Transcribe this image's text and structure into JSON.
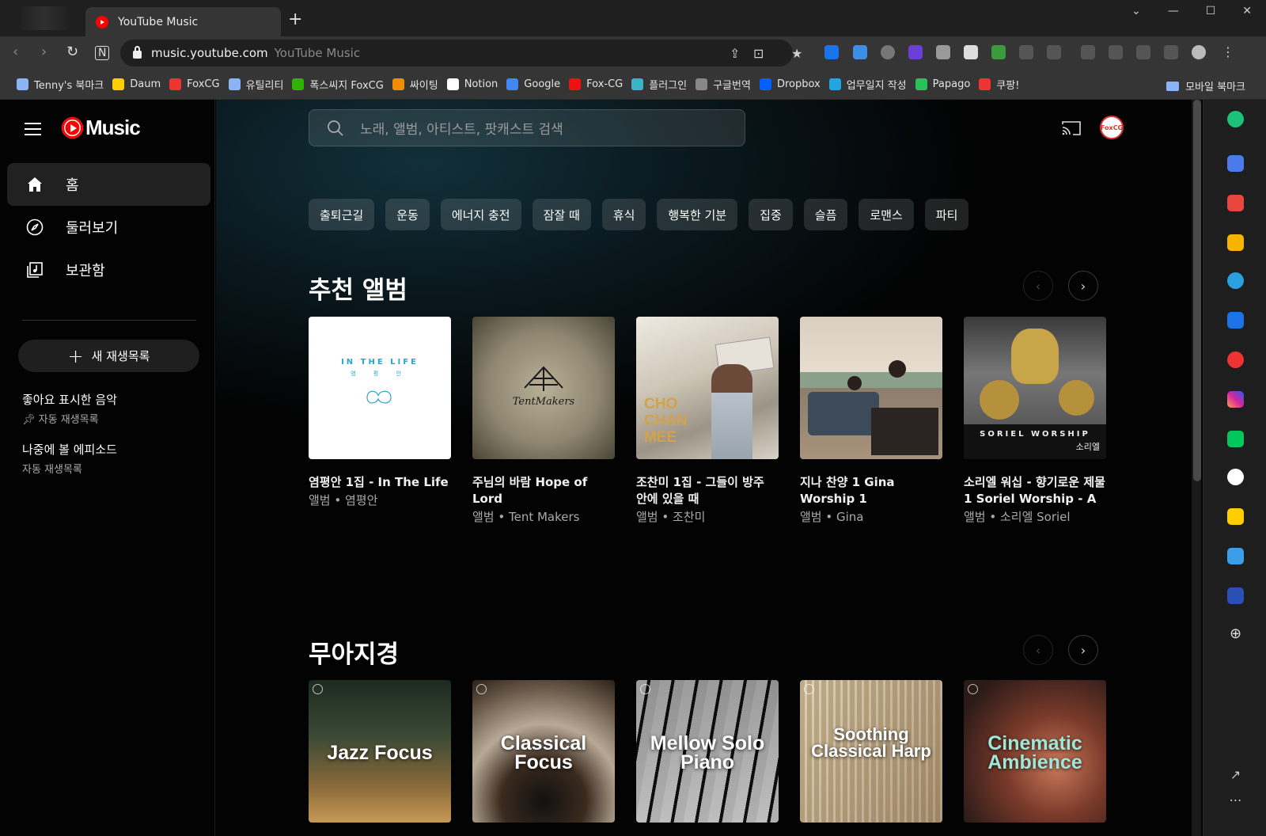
{
  "browser": {
    "tab_title": "YouTube Music",
    "new_tab": "+",
    "url": "music.youtube.com",
    "page_title": "YouTube Music",
    "bookmarks": [
      {
        "label": "Tenny's 북마크",
        "color": "#8ab4f8"
      },
      {
        "label": "Daum",
        "color": "#ffcd00"
      },
      {
        "label": "FoxCG",
        "color": "#e33"
      },
      {
        "label": "유틸리티",
        "color": "#8ab4f8"
      },
      {
        "label": "폭스씨지 FoxCG",
        "color": "#2db400"
      },
      {
        "label": "싸이팅",
        "color": "#f28c00"
      },
      {
        "label": "Notion",
        "color": "#ffffff"
      },
      {
        "label": "Google",
        "color": "#4285f4"
      },
      {
        "label": "Fox-CG",
        "color": "#e11"
      },
      {
        "label": "플러그인",
        "color": "#3cb4c8"
      },
      {
        "label": "구글번역",
        "color": "#888888"
      },
      {
        "label": "Dropbox",
        "color": "#0061ff"
      },
      {
        "label": "업무일지 작성",
        "color": "#1ea7e1"
      },
      {
        "label": "Papago",
        "color": "#28c15a"
      },
      {
        "label": "쿠팡!",
        "color": "#e33"
      }
    ],
    "mobile_bookmarks": "모바일 북마크"
  },
  "app": {
    "logo_text": "Music",
    "nav": [
      {
        "label": "홈",
        "icon": "home-icon",
        "active": true
      },
      {
        "label": "둘러보기",
        "icon": "compass-icon",
        "active": false
      },
      {
        "label": "보관함",
        "icon": "library-icon",
        "active": false
      }
    ],
    "new_playlist": "새 재생목록",
    "library": [
      {
        "title": "좋아요 표시한 음악",
        "subtitle": "자동 재생목록",
        "pinned": true
      },
      {
        "title": "나중에 볼 에피소드",
        "subtitle": "자동 재생목록",
        "pinned": false
      }
    ],
    "search_placeholder": "노래, 앨범, 아티스트, 팟캐스트 검색",
    "avatar_text": "FoxCG",
    "chips": [
      "출퇴근길",
      "운동",
      "에너지 충전",
      "잠잘 때",
      "휴식",
      "행복한 기분",
      "집중",
      "슬픔",
      "로맨스",
      "파티"
    ],
    "shelves": [
      {
        "title": "추천 앨범",
        "cards": [
          {
            "title": "염평안 1집 - In The Life",
            "subtitle": "앨범 • 염평안",
            "cover_text": "IN THE LIFE",
            "cover_sub": "염 평 안"
          },
          {
            "title": "주님의 바람 Hope of Lord",
            "subtitle": "앨범 • Tent Makers",
            "cover_text": "TentMakers"
          },
          {
            "title": "조찬미 1집 - 그들이 방주 안에 있을 때",
            "subtitle": "앨범 • 조찬미",
            "cover_text": "CHO CHAN MEE"
          },
          {
            "title": "지나 찬양 1 Gina Worship 1",
            "subtitle": "앨범 • Gina"
          },
          {
            "title": "소리엘 워십 - 향기로운 제물 1 Soriel Worship - A",
            "subtitle": "앨범 • 소리엘 Soriel",
            "cover_text": "SORIEL WORSHIP",
            "cover_sub": "소리엘"
          }
        ]
      },
      {
        "title": "무아지경",
        "cards": [
          {
            "cover_text": "Jazz Focus"
          },
          {
            "cover_text": "Classical Focus"
          },
          {
            "cover_text": "Mellow Solo Piano"
          },
          {
            "cover_text": "Soothing Classical Harp"
          },
          {
            "cover_text": "Cinematic Ambience"
          }
        ]
      }
    ]
  }
}
